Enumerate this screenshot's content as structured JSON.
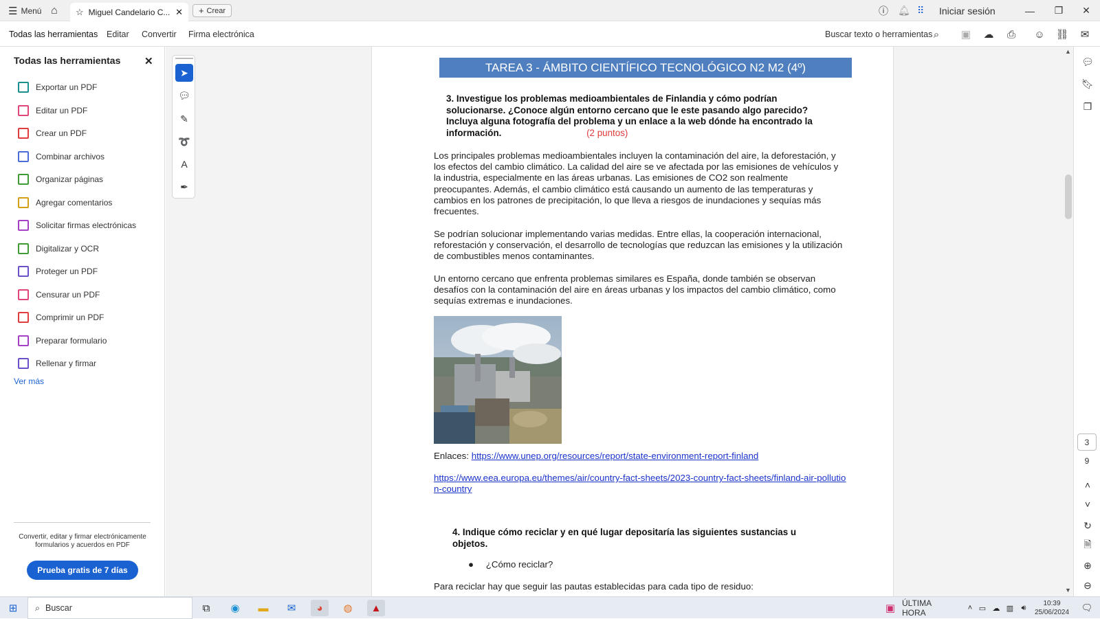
{
  "titlebar": {
    "menu_label": "Menú",
    "tab_title": "Miguel Candelario C...",
    "create_label": "Crear",
    "signin_label": "Iniciar sesión"
  },
  "menubar": {
    "items": [
      "Todas las herramientas",
      "Editar",
      "Convertir",
      "Firma electrónica"
    ],
    "search_label": "Buscar texto o herramientas"
  },
  "left_panel": {
    "title": "Todas las herramientas",
    "items": [
      {
        "label": "Exportar un PDF",
        "icon": "export-pdf-icon",
        "color": "#1a8f8f"
      },
      {
        "label": "Editar un PDF",
        "icon": "edit-pdf-icon",
        "color": "#e0457b"
      },
      {
        "label": "Crear un PDF",
        "icon": "create-pdf-icon",
        "color": "#e03c3c"
      },
      {
        "label": "Combinar archivos",
        "icon": "combine-files-icon",
        "color": "#4a6cd4"
      },
      {
        "label": "Organizar páginas",
        "icon": "organize-pages-icon",
        "color": "#3f9c35"
      },
      {
        "label": "Agregar comentarios",
        "icon": "add-comments-icon",
        "color": "#d4a017"
      },
      {
        "label": "Solicitar firmas electrónicas",
        "icon": "request-signatures-icon",
        "color": "#a340c4"
      },
      {
        "label": "Digitalizar y OCR",
        "icon": "scan-ocr-icon",
        "color": "#3f9c35"
      },
      {
        "label": "Proteger un PDF",
        "icon": "protect-pdf-icon",
        "color": "#6b4fc9"
      },
      {
        "label": "Censurar un PDF",
        "icon": "redact-pdf-icon",
        "color": "#e0457b"
      },
      {
        "label": "Comprimir un PDF",
        "icon": "compress-pdf-icon",
        "color": "#e03c3c"
      },
      {
        "label": "Preparar formulario",
        "icon": "prepare-form-icon",
        "color": "#a340c4"
      },
      {
        "label": "Rellenar y firmar",
        "icon": "fill-sign-icon",
        "color": "#6b4fc9"
      }
    ],
    "see_more": "Ver más",
    "promo_text": "Convertir, editar y firmar electrónicamente formularios y acuerdos en PDF",
    "trial_button": "Prueba gratis de 7 días"
  },
  "document": {
    "banner": "TAREA 3  - ÁMBITO CIENTÍFICO TECNOLÓGICO N2 M2 (4º)",
    "q3": "3. Investigue los problemas medioambientales de Finlandia  y cómo podrían solucionarse. ¿Conoce algún entorno cercano que le este pasando algo parecido? Incluya alguna fotografía del problema y un enlace a la web dónde ha encontrado la información.",
    "q3_points": "(2 puntos)",
    "para1": "Los principales problemas medioambientales incluyen la contaminación del aire, la deforestación, y los efectos del cambio climático. La calidad del aire se ve afectada por las emisiones de vehículos y la industria, especialmente en las áreas urbanas. Las emisiones de CO2 son realmente preocupantes. Además, el cambio climático está causando un aumento de las temperaturas y cambios en los patrones de precipitación, lo que lleva a riesgos de inundaciones y sequías más frecuentes.",
    "para2": "Se podrían solucionar implementando varias medidas. Entre ellas, la cooperación internacional, reforestación y conservación, el desarrollo de tecnologías que reduzcan las emisiones y la utilización de combustibles menos contaminantes.",
    "para3": "Un entorno cercano que enfrenta problemas similares es España, donde también se observan desafíos con la contaminación del aire en áreas urbanas y los impactos del cambio climático, como sequías extremas e inundaciones.",
    "links_label": "Enlaces:",
    "link1": "https://www.unep.org/resources/report/state-environment-report-finland",
    "link2": "https://www.eea.europa.eu/themes/air/country-fact-sheets/2023-country-fact-sheets/finland-air-pollution-country",
    "q4": "4. Indique cómo reciclar y en qué lugar depositaría las siguientes sustancias u objetos.",
    "bullet1": "¿Cómo reciclar?",
    "cut_line": "Para reciclar hay que seguir las pautas establecidas para cada tipo de residuo:"
  },
  "pager": {
    "current": "3",
    "total": "9"
  },
  "taskbar": {
    "search_label": "Buscar",
    "news_label": "ÚLTIMA HORA",
    "time": "10:39",
    "date": "25/06/2024"
  }
}
